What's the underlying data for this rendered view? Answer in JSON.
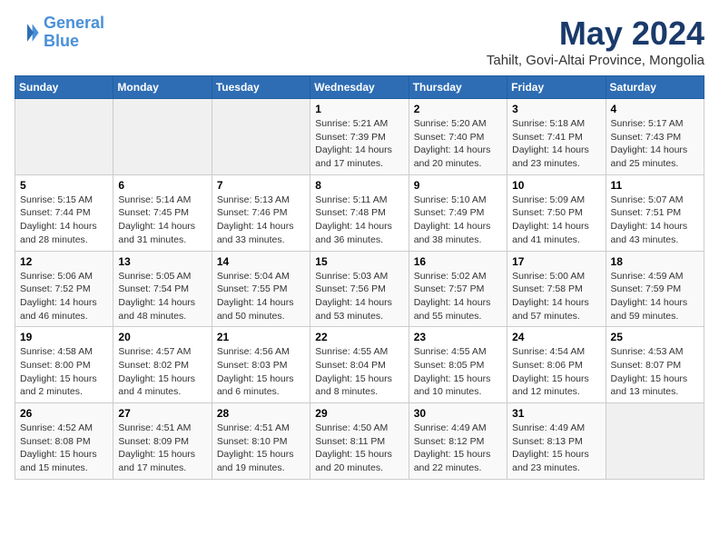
{
  "logo": {
    "line1": "General",
    "line2": "Blue"
  },
  "title": "May 2024",
  "subtitle": "Tahilt, Govi-Altai Province, Mongolia",
  "days_header": [
    "Sunday",
    "Monday",
    "Tuesday",
    "Wednesday",
    "Thursday",
    "Friday",
    "Saturday"
  ],
  "weeks": [
    [
      {
        "day": "",
        "sunrise": "",
        "sunset": "",
        "daylight": ""
      },
      {
        "day": "",
        "sunrise": "",
        "sunset": "",
        "daylight": ""
      },
      {
        "day": "",
        "sunrise": "",
        "sunset": "",
        "daylight": ""
      },
      {
        "day": "1",
        "sunrise": "Sunrise: 5:21 AM",
        "sunset": "Sunset: 7:39 PM",
        "daylight": "Daylight: 14 hours and 17 minutes."
      },
      {
        "day": "2",
        "sunrise": "Sunrise: 5:20 AM",
        "sunset": "Sunset: 7:40 PM",
        "daylight": "Daylight: 14 hours and 20 minutes."
      },
      {
        "day": "3",
        "sunrise": "Sunrise: 5:18 AM",
        "sunset": "Sunset: 7:41 PM",
        "daylight": "Daylight: 14 hours and 23 minutes."
      },
      {
        "day": "4",
        "sunrise": "Sunrise: 5:17 AM",
        "sunset": "Sunset: 7:43 PM",
        "daylight": "Daylight: 14 hours and 25 minutes."
      }
    ],
    [
      {
        "day": "5",
        "sunrise": "Sunrise: 5:15 AM",
        "sunset": "Sunset: 7:44 PM",
        "daylight": "Daylight: 14 hours and 28 minutes."
      },
      {
        "day": "6",
        "sunrise": "Sunrise: 5:14 AM",
        "sunset": "Sunset: 7:45 PM",
        "daylight": "Daylight: 14 hours and 31 minutes."
      },
      {
        "day": "7",
        "sunrise": "Sunrise: 5:13 AM",
        "sunset": "Sunset: 7:46 PM",
        "daylight": "Daylight: 14 hours and 33 minutes."
      },
      {
        "day": "8",
        "sunrise": "Sunrise: 5:11 AM",
        "sunset": "Sunset: 7:48 PM",
        "daylight": "Daylight: 14 hours and 36 minutes."
      },
      {
        "day": "9",
        "sunrise": "Sunrise: 5:10 AM",
        "sunset": "Sunset: 7:49 PM",
        "daylight": "Daylight: 14 hours and 38 minutes."
      },
      {
        "day": "10",
        "sunrise": "Sunrise: 5:09 AM",
        "sunset": "Sunset: 7:50 PM",
        "daylight": "Daylight: 14 hours and 41 minutes."
      },
      {
        "day": "11",
        "sunrise": "Sunrise: 5:07 AM",
        "sunset": "Sunset: 7:51 PM",
        "daylight": "Daylight: 14 hours and 43 minutes."
      }
    ],
    [
      {
        "day": "12",
        "sunrise": "Sunrise: 5:06 AM",
        "sunset": "Sunset: 7:52 PM",
        "daylight": "Daylight: 14 hours and 46 minutes."
      },
      {
        "day": "13",
        "sunrise": "Sunrise: 5:05 AM",
        "sunset": "Sunset: 7:54 PM",
        "daylight": "Daylight: 14 hours and 48 minutes."
      },
      {
        "day": "14",
        "sunrise": "Sunrise: 5:04 AM",
        "sunset": "Sunset: 7:55 PM",
        "daylight": "Daylight: 14 hours and 50 minutes."
      },
      {
        "day": "15",
        "sunrise": "Sunrise: 5:03 AM",
        "sunset": "Sunset: 7:56 PM",
        "daylight": "Daylight: 14 hours and 53 minutes."
      },
      {
        "day": "16",
        "sunrise": "Sunrise: 5:02 AM",
        "sunset": "Sunset: 7:57 PM",
        "daylight": "Daylight: 14 hours and 55 minutes."
      },
      {
        "day": "17",
        "sunrise": "Sunrise: 5:00 AM",
        "sunset": "Sunset: 7:58 PM",
        "daylight": "Daylight: 14 hours and 57 minutes."
      },
      {
        "day": "18",
        "sunrise": "Sunrise: 4:59 AM",
        "sunset": "Sunset: 7:59 PM",
        "daylight": "Daylight: 14 hours and 59 minutes."
      }
    ],
    [
      {
        "day": "19",
        "sunrise": "Sunrise: 4:58 AM",
        "sunset": "Sunset: 8:00 PM",
        "daylight": "Daylight: 15 hours and 2 minutes."
      },
      {
        "day": "20",
        "sunrise": "Sunrise: 4:57 AM",
        "sunset": "Sunset: 8:02 PM",
        "daylight": "Daylight: 15 hours and 4 minutes."
      },
      {
        "day": "21",
        "sunrise": "Sunrise: 4:56 AM",
        "sunset": "Sunset: 8:03 PM",
        "daylight": "Daylight: 15 hours and 6 minutes."
      },
      {
        "day": "22",
        "sunrise": "Sunrise: 4:55 AM",
        "sunset": "Sunset: 8:04 PM",
        "daylight": "Daylight: 15 hours and 8 minutes."
      },
      {
        "day": "23",
        "sunrise": "Sunrise: 4:55 AM",
        "sunset": "Sunset: 8:05 PM",
        "daylight": "Daylight: 15 hours and 10 minutes."
      },
      {
        "day": "24",
        "sunrise": "Sunrise: 4:54 AM",
        "sunset": "Sunset: 8:06 PM",
        "daylight": "Daylight: 15 hours and 12 minutes."
      },
      {
        "day": "25",
        "sunrise": "Sunrise: 4:53 AM",
        "sunset": "Sunset: 8:07 PM",
        "daylight": "Daylight: 15 hours and 13 minutes."
      }
    ],
    [
      {
        "day": "26",
        "sunrise": "Sunrise: 4:52 AM",
        "sunset": "Sunset: 8:08 PM",
        "daylight": "Daylight: 15 hours and 15 minutes."
      },
      {
        "day": "27",
        "sunrise": "Sunrise: 4:51 AM",
        "sunset": "Sunset: 8:09 PM",
        "daylight": "Daylight: 15 hours and 17 minutes."
      },
      {
        "day": "28",
        "sunrise": "Sunrise: 4:51 AM",
        "sunset": "Sunset: 8:10 PM",
        "daylight": "Daylight: 15 hours and 19 minutes."
      },
      {
        "day": "29",
        "sunrise": "Sunrise: 4:50 AM",
        "sunset": "Sunset: 8:11 PM",
        "daylight": "Daylight: 15 hours and 20 minutes."
      },
      {
        "day": "30",
        "sunrise": "Sunrise: 4:49 AM",
        "sunset": "Sunset: 8:12 PM",
        "daylight": "Daylight: 15 hours and 22 minutes."
      },
      {
        "day": "31",
        "sunrise": "Sunrise: 4:49 AM",
        "sunset": "Sunset: 8:13 PM",
        "daylight": "Daylight: 15 hours and 23 minutes."
      },
      {
        "day": "",
        "sunrise": "",
        "sunset": "",
        "daylight": ""
      }
    ]
  ]
}
